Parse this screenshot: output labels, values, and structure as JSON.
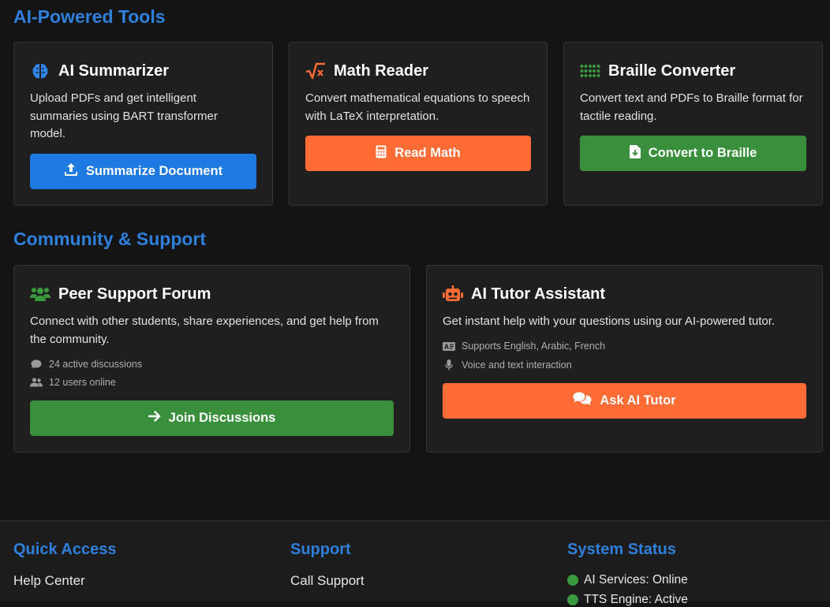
{
  "ai_tools": {
    "title": "AI-Powered Tools",
    "cards": [
      {
        "icon": "brain-icon",
        "title": "AI Summarizer",
        "description": "Upload PDFs and get intelligent summaries using BART transformer model.",
        "button": {
          "icon": "upload-icon",
          "label": "Summarize Document",
          "color": "#1e7ae0"
        }
      },
      {
        "icon": "square-root-icon",
        "title": "Math Reader",
        "description": "Convert mathematical equations to speech with LaTeX interpretation.",
        "button": {
          "icon": "calculator-icon",
          "label": "Read Math",
          "color": "#ff6b35"
        }
      },
      {
        "icon": "braille-icon",
        "title": "Braille Converter",
        "description": "Convert text and PDFs to Braille format for tactile reading.",
        "button": {
          "icon": "file-download-icon",
          "label": "Convert to Braille",
          "color": "#3a8f3c"
        }
      }
    ]
  },
  "community": {
    "title": "Community & Support",
    "forum": {
      "icon": "users-icon",
      "title": "Peer Support Forum",
      "description": "Connect with other students, share experiences, and get help from the community.",
      "stats": [
        {
          "icon": "comment-icon",
          "text": "24 active discussions"
        },
        {
          "icon": "user-group-icon",
          "text": "12 users online"
        }
      ],
      "button": {
        "icon": "arrow-right-icon",
        "label": "Join Discussions",
        "color": "#3a8f3c"
      }
    },
    "tutor": {
      "icon": "robot-icon",
      "title": "AI Tutor Assistant",
      "description": "Get instant help with your questions using our AI-powered tutor.",
      "features": [
        {
          "icon": "language-icon",
          "text": "Supports English, Arabic, French"
        },
        {
          "icon": "microphone-icon",
          "text": "Voice and text interaction"
        }
      ],
      "button": {
        "icon": "comments-icon",
        "label": "Ask AI Tutor",
        "color": "#ff6b35"
      }
    }
  },
  "footer": {
    "quick_access": {
      "title": "Quick Access",
      "link": "Help Center"
    },
    "support": {
      "title": "Support",
      "link": "Call Support"
    },
    "system_status": {
      "title": "System Status",
      "items": [
        "AI Services: Online",
        "TTS Engine: Active"
      ],
      "status_color": "#3a9a3d"
    }
  },
  "colors": {
    "accent": "#2f7fdc",
    "background": "#141414",
    "card": "#1f1f1f"
  }
}
